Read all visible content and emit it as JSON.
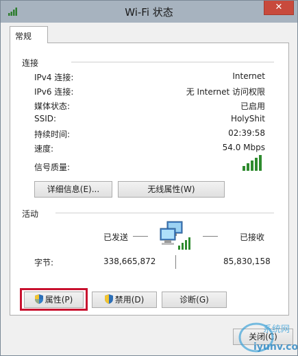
{
  "window": {
    "title": "Wi-Fi 状态",
    "close_glyph": "✕"
  },
  "tabs": [
    {
      "label": "常规"
    }
  ],
  "connection": {
    "heading": "连接",
    "rows": [
      {
        "label": "IPv4 连接:",
        "value": "Internet"
      },
      {
        "label": "IPv6 连接:",
        "value": "无 Internet 访问权限"
      },
      {
        "label": "媒体状态:",
        "value": "已启用"
      },
      {
        "label": "SSID:",
        "value": "HolyShit"
      },
      {
        "label": "持续时间:",
        "value": "02:39:58"
      },
      {
        "label": "速度:",
        "value": "54.0 Mbps"
      }
    ],
    "signal_label": "信号质量:",
    "signal_bars": 5,
    "signal_icon": "signal-bars-icon",
    "details_button": "详细信息(E)...",
    "wireless_button": "无线属性(W)"
  },
  "activity": {
    "heading": "活动",
    "sent_label": "已发送",
    "received_label": "已接收",
    "bytes_label": "字节:",
    "bytes_sent": "338,665,872",
    "bytes_received": "85,830,158",
    "network_icon": "network-computers-icon"
  },
  "buttons": {
    "properties": "属性(P)",
    "disable": "禁用(D)",
    "diagnose": "诊断(G)",
    "close": "关闭(C)"
  },
  "colors": {
    "accent_green": "#2e8b2e",
    "highlight_red": "#c8102e",
    "titlebar": "#a7b3bf"
  },
  "watermark": {
    "text": "系统网",
    "url": "iyunv.com"
  }
}
